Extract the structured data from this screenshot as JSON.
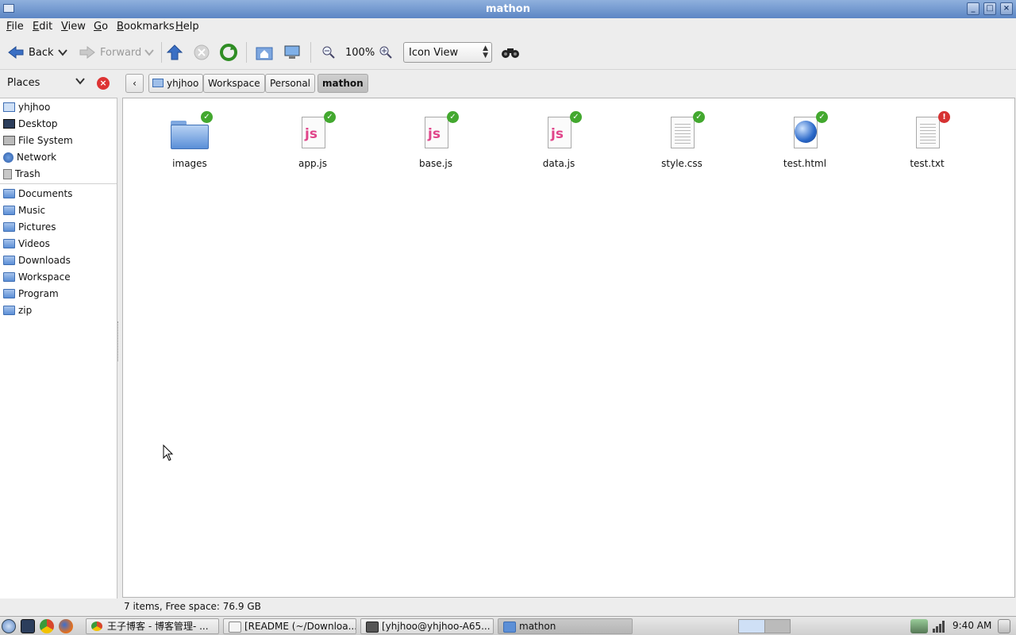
{
  "window": {
    "title": "mathon"
  },
  "menu": [
    {
      "label": "File",
      "key": "F",
      "rest": "ile"
    },
    {
      "label": "Edit",
      "key": "E",
      "rest": "dit"
    },
    {
      "label": "View",
      "key": "V",
      "rest": "iew"
    },
    {
      "label": "Go",
      "key": "G",
      "rest": "o"
    },
    {
      "label": "Bookmarks",
      "key": "B",
      "rest": "ookmarks"
    },
    {
      "label": "Help",
      "key": "H",
      "rest": "elp"
    }
  ],
  "toolbar": {
    "back_label": "Back",
    "forward_label": "Forward",
    "zoom_value": "100%",
    "view_mode": "Icon View"
  },
  "places": {
    "header": "Places",
    "items": [
      {
        "label": "yhjhoo",
        "icon": "home-folder-icon"
      },
      {
        "label": "Desktop",
        "icon": "desktop-icon"
      },
      {
        "label": "File System",
        "icon": "drive-icon"
      },
      {
        "label": "Network",
        "icon": "network-icon"
      },
      {
        "label": "Trash",
        "icon": "trash-icon"
      }
    ],
    "bookmarks": [
      {
        "label": "Documents"
      },
      {
        "label": "Music"
      },
      {
        "label": "Pictures"
      },
      {
        "label": "Videos"
      },
      {
        "label": "Downloads"
      },
      {
        "label": "Workspace"
      },
      {
        "label": "Program"
      },
      {
        "label": "zip"
      }
    ]
  },
  "breadcrumb": [
    "yhjhoo",
    "Workspace",
    "Personal",
    "mathon"
  ],
  "files": [
    {
      "name": "images",
      "type": "folder",
      "emblem": "ok"
    },
    {
      "name": "app.js",
      "type": "js",
      "emblem": "ok"
    },
    {
      "name": "base.js",
      "type": "js",
      "emblem": "ok"
    },
    {
      "name": "data.js",
      "type": "js",
      "emblem": "ok"
    },
    {
      "name": "style.css",
      "type": "text",
      "emblem": "ok"
    },
    {
      "name": "test.html",
      "type": "html",
      "emblem": "ok"
    },
    {
      "name": "test.txt",
      "type": "text",
      "emblem": "warn"
    }
  ],
  "status": {
    "text": "7 items, Free space: 76.9 GB"
  },
  "taskbar": {
    "tasks": [
      {
        "label": "王子博客 - 博客管理- ...",
        "color": "#d8472b"
      },
      {
        "label": "[README (~/Downloa...",
        "color": "#eeeeee"
      },
      {
        "label": "[yhjhoo@yhjhoo-A65...",
        "color": "#555555"
      },
      {
        "label": "mathon",
        "color": "#5c8fd6"
      }
    ],
    "clock": "9:40 AM"
  },
  "colors": {
    "emblem_ok": "#43a82f",
    "emblem_warn": "#d63232",
    "folder": "#5c8fd6",
    "js_label": "#e0458a"
  }
}
